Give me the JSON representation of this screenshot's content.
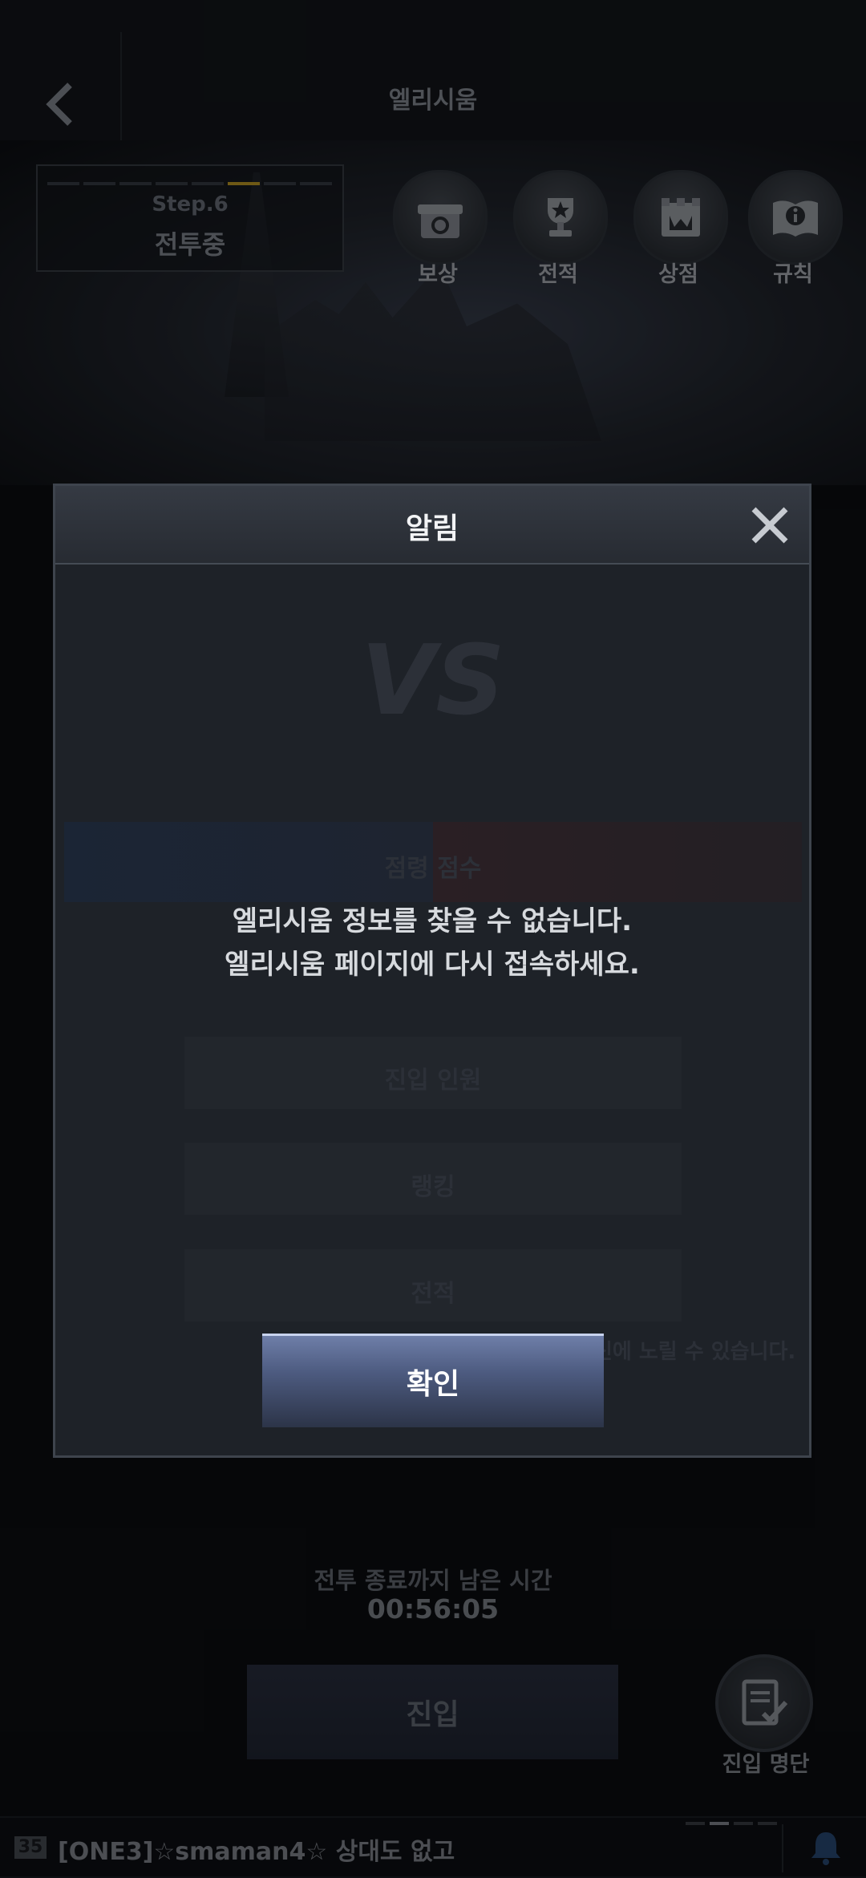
{
  "header": {
    "title": "엘리시움"
  },
  "status": {
    "step": "Step.6",
    "state": "전투중"
  },
  "menu": [
    {
      "label": "보상",
      "icon": "gift-icon"
    },
    {
      "label": "전적",
      "icon": "trophy-icon"
    },
    {
      "label": "상점",
      "icon": "shop-icon"
    },
    {
      "label": "규칙",
      "icon": "rules-book-icon"
    }
  ],
  "modal": {
    "title": "알림",
    "message_line1": "엘리시움 정보를 찾을 수 없습니다.",
    "message_line2": "엘리시움 페이지에 다시 접속하세요.",
    "confirm_label": "확인"
  },
  "background_ghost": {
    "vs": "VS",
    "row1": "점령 점수",
    "row2": "진입 인원",
    "row3": "랭킹",
    "row4": "전적",
    "note": "신에 노릴 수 있습니다."
  },
  "timer": {
    "label": "전투 종료까지 남은 시간",
    "value": "00:56:05"
  },
  "enter_button": "진입",
  "roster_button": "진입 명단",
  "chat": {
    "level": "35",
    "text": "[ONE3]☆smaman4☆ 상대도 없고"
  },
  "colors": {
    "confirm_button": "#4d5b80",
    "progress_active": "#c9a227"
  }
}
